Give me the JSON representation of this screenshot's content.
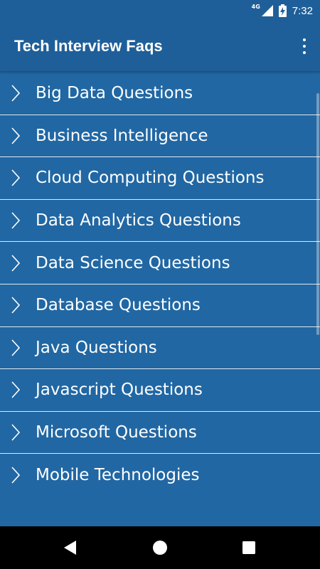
{
  "status_bar": {
    "network": "4G",
    "time": "7:32",
    "icons": [
      "signal-icon",
      "battery-charging-icon"
    ]
  },
  "app_bar": {
    "title": "Tech Interview Faqs",
    "menu_icon": "more-vert-icon"
  },
  "list": {
    "items": [
      {
        "label": "Big Data Questions"
      },
      {
        "label": "Business Intelligence"
      },
      {
        "label": "Cloud Computing Questions"
      },
      {
        "label": "Data Analytics Questions"
      },
      {
        "label": "Data Science Questions"
      },
      {
        "label": "Database Questions"
      },
      {
        "label": "Java Questions"
      },
      {
        "label": "Javascript Questions"
      },
      {
        "label": "Microsoft Questions"
      },
      {
        "label": "Mobile Technologies"
      }
    ]
  },
  "nav_bar": {
    "icons": [
      "back-icon",
      "home-icon",
      "recent-apps-icon"
    ]
  },
  "colors": {
    "background": "#2167a3",
    "app_bar": "#1f5f99",
    "text": "#ffffff",
    "nav_bar": "#000000"
  }
}
